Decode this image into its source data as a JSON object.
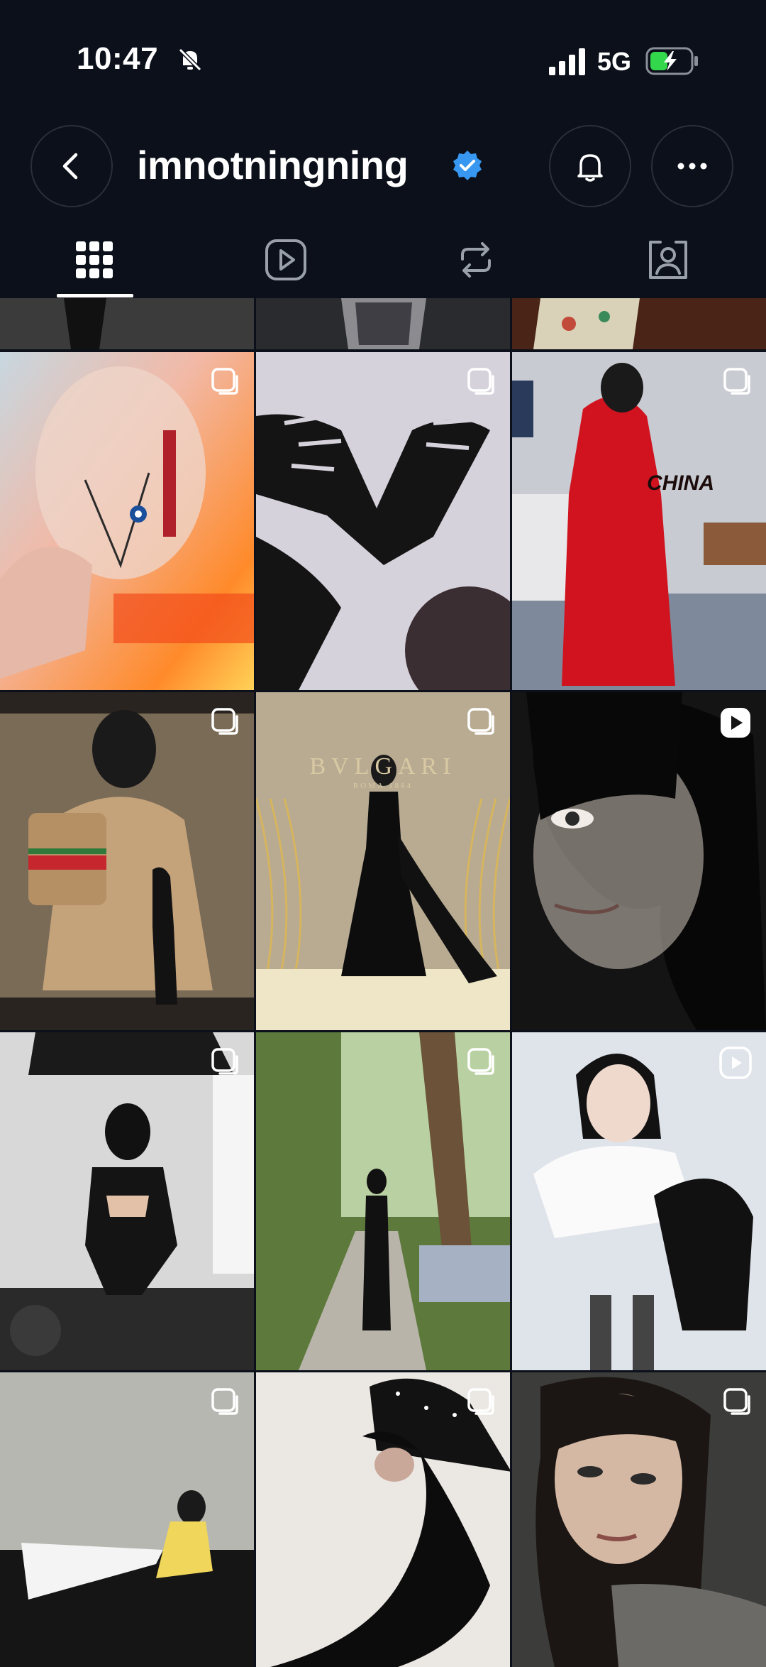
{
  "status_bar": {
    "time": "10:47",
    "network": "5G",
    "icons": [
      "bell-slash-icon",
      "cellular-signal-icon",
      "battery-charging-icon"
    ]
  },
  "header": {
    "username": "imnotningning",
    "verified": true,
    "icons": [
      "chevron-left-icon",
      "verified-badge-icon",
      "bell-icon",
      "more-horizontal-icon"
    ]
  },
  "tabs": [
    {
      "name": "posts-grid",
      "icon": "grid-icon",
      "active": true
    },
    {
      "name": "reels",
      "icon": "play-icon",
      "active": false
    },
    {
      "name": "reposts",
      "icon": "repost-icon",
      "active": false
    },
    {
      "name": "tagged",
      "icon": "person-tag-icon",
      "active": false
    }
  ],
  "posts": [
    {
      "type": "carousel",
      "bg": "#2a2a2a"
    },
    {
      "type": "carousel",
      "bg": "#1f2126"
    },
    {
      "type": "carousel",
      "bg": "#3a1f14"
    },
    {
      "type": "carousel",
      "bg": "#e8b39a"
    },
    {
      "type": "carousel",
      "bg": "#d6d2dc"
    },
    {
      "type": "carousel",
      "bg": "#c8ccd2"
    },
    {
      "type": "carousel",
      "bg": "#7a6b57"
    },
    {
      "type": "carousel",
      "bg": "#b8ab92",
      "brand": "BVLGARI",
      "brand_sub": "ROMA 1884"
    },
    {
      "type": "reel",
      "bg": "#141414"
    },
    {
      "type": "carousel",
      "bg": "#d8d8d8"
    },
    {
      "type": "carousel",
      "bg": "#5d7a3c"
    },
    {
      "type": "reel",
      "bg": "#dfe3ea"
    },
    {
      "type": "carousel",
      "bg": "#b7b7b2"
    },
    {
      "type": "carousel",
      "bg": "#ebe7e3"
    },
    {
      "type": "carousel",
      "bg": "#3c3c3a"
    }
  ],
  "post_texts": {
    "jacket": "CHINA"
  },
  "colors": {
    "background": "#0b101a",
    "verified_blue": "#3897f0",
    "button_border": "#2a303b"
  }
}
